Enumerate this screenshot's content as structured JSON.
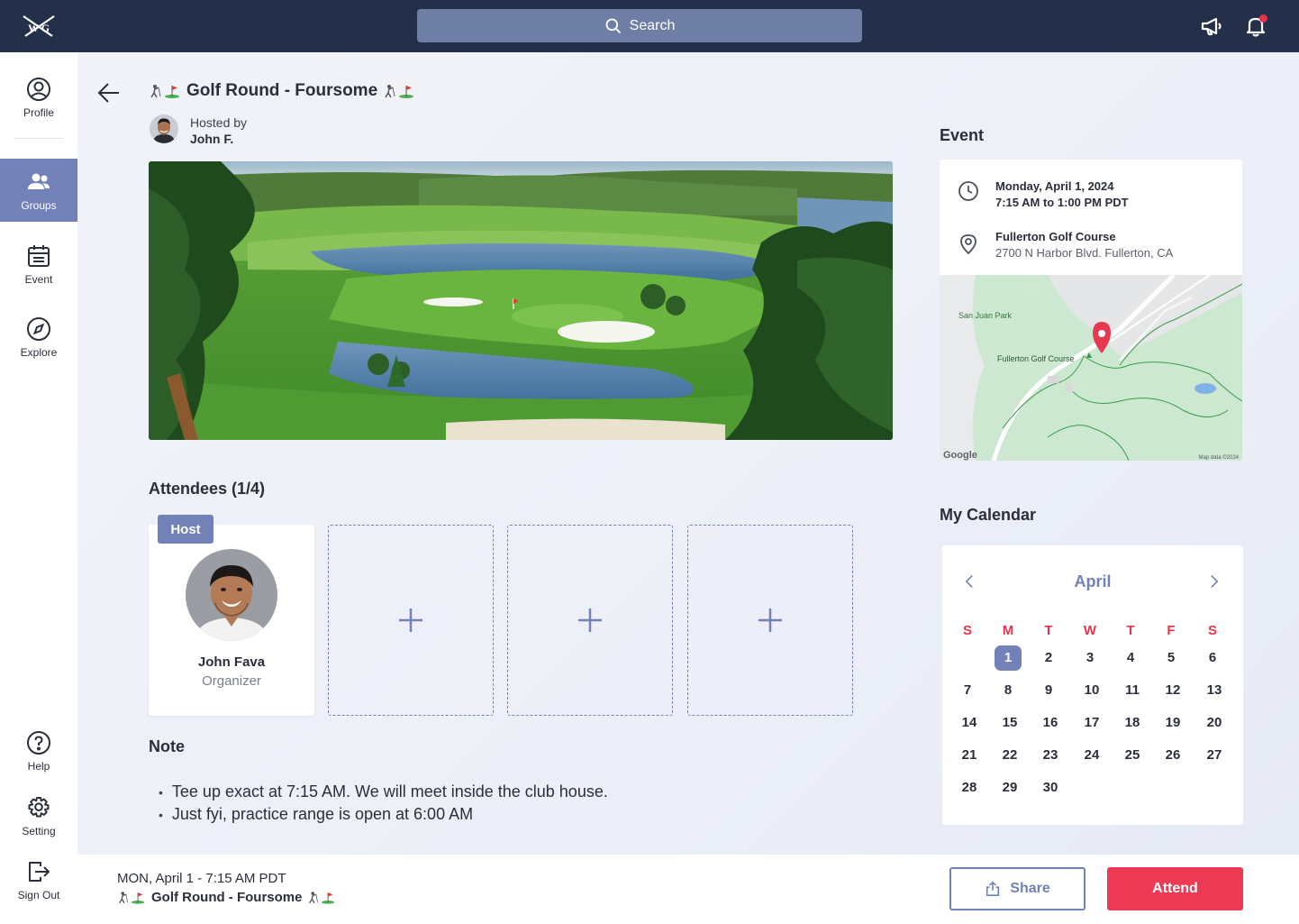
{
  "app": {
    "logo_text": "W G"
  },
  "search": {
    "label": "Search"
  },
  "sidebar": {
    "items": [
      {
        "label": "Profile",
        "icon": "user-circle-icon"
      },
      {
        "label": "Groups",
        "icon": "users-icon"
      },
      {
        "label": "Event",
        "icon": "calendar-icon"
      },
      {
        "label": "Explore",
        "icon": "compass-icon"
      },
      {
        "label": "Help",
        "icon": "help-icon"
      },
      {
        "label": "Setting",
        "icon": "gear-icon"
      },
      {
        "label": "Sign Out",
        "icon": "sign-out-icon"
      }
    ],
    "active": "Groups"
  },
  "event": {
    "title": "Golf Round - Foursome",
    "hosted_by_label": "Hosted by",
    "host_short": "John F.",
    "section_title": "Event",
    "date": "Monday, April 1, 2024",
    "time": "7:15 AM to 1:00 PM PDT",
    "venue": "Fullerton Golf Course",
    "address": "2700 N Harbor Blvd. Fullerton, CA"
  },
  "map": {
    "label_park": "San Juan Park",
    "label_course": "Fullerton Golf Course",
    "google": "Google",
    "attribution": "Map data ©2024"
  },
  "attendees": {
    "title": "Attendees (1/4)",
    "host_badge": "Host",
    "host_name": "John Fava",
    "host_role": "Organizer",
    "empty_slots": 3
  },
  "note": {
    "title": "Note",
    "items": [
      "Tee up exact at 7:15 AM. We will meet inside the club house.",
      "Just fyi, practice range is open at 6:00 AM"
    ]
  },
  "calendar": {
    "title": "My Calendar",
    "month": "April",
    "weekdays": [
      "S",
      "M",
      "T",
      "W",
      "T",
      "F",
      "S"
    ],
    "first_weekday": 1,
    "days": 30,
    "selected_day": 1
  },
  "footer": {
    "date": "MON, April 1 - 7:15 AM PDT",
    "title": "Golf Round - Foursome",
    "share_label": "Share",
    "attend_label": "Attend"
  },
  "colors": {
    "accent": "#7282b8",
    "attend": "#ec3a55",
    "topbar": "#24304a",
    "weekday": "#e8324f"
  }
}
